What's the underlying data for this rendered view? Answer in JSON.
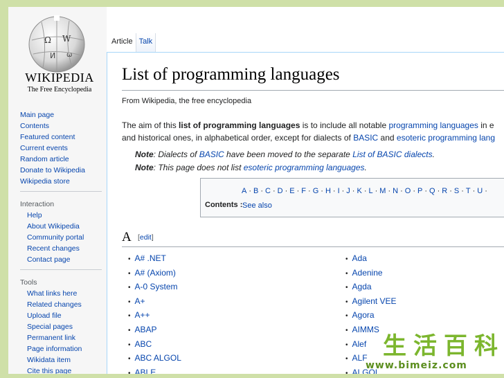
{
  "sidebar": {
    "wordmark": "WIKIPEDIA",
    "tagline": "The Free Encyclopedia",
    "main_links": [
      "Main page",
      "Contents",
      "Featured content",
      "Current events",
      "Random article",
      "Donate to Wikipedia",
      "Wikipedia store"
    ],
    "interaction_heading": "Interaction",
    "interaction_links": [
      "Help",
      "About Wikipedia",
      "Community portal",
      "Recent changes",
      "Contact page"
    ],
    "tools_heading": "Tools",
    "tools_links": [
      "What links here",
      "Related changes",
      "Upload file",
      "Special pages",
      "Permanent link",
      "Page information",
      "Wikidata item",
      "Cite this page"
    ]
  },
  "tabs": [
    "Article",
    "Talk"
  ],
  "page": {
    "title": "List of programming languages",
    "from": "From Wikipedia, the free encyclopedia",
    "intro_line1": {
      "pre": "The aim of this ",
      "bold": "list of programming languages",
      "mid": " is to include all notable ",
      "link": "programming languages",
      "post": " in e"
    },
    "intro_line2": {
      "pre": "and historical ones, in alphabetical order, except for dialects of ",
      "link1": "BASIC",
      "mid": " and ",
      "link2": "esoteric programming lang"
    },
    "note1": {
      "label": "Note",
      "pre": ": Dialects of ",
      "link1": "BASIC",
      "mid": " have been moved to the separate ",
      "link2": "List of BASIC dialects",
      "post": "."
    },
    "note2": {
      "label": "Note",
      "pre": ": This page does not list ",
      "link": "esoteric programming languages",
      "post": "."
    }
  },
  "toc": {
    "letters": [
      "A",
      "B",
      "C",
      "D",
      "E",
      "F",
      "G",
      "H",
      "I",
      "J",
      "K",
      "L",
      "M",
      "N",
      "O",
      "P",
      "Q",
      "R",
      "S",
      "T",
      "U"
    ],
    "label": "Contents :",
    "see_also": "See also"
  },
  "section": {
    "heading": "A",
    "edit": "edit",
    "col1": [
      "A# .NET",
      "A# (Axiom)",
      "A-0 System",
      "A+",
      "A++",
      "ABAP",
      "ABC",
      "ABC ALGOL",
      "ABLE"
    ],
    "col2": [
      "Ada",
      "Adenine",
      "Agda",
      "Agilent VEE",
      "Agora",
      "AIMMS",
      "Alef",
      "ALF",
      "ALGOL"
    ]
  },
  "watermark": {
    "chars": [
      "生",
      "活",
      "百",
      "科"
    ],
    "url": "www.bimeiz.com"
  }
}
